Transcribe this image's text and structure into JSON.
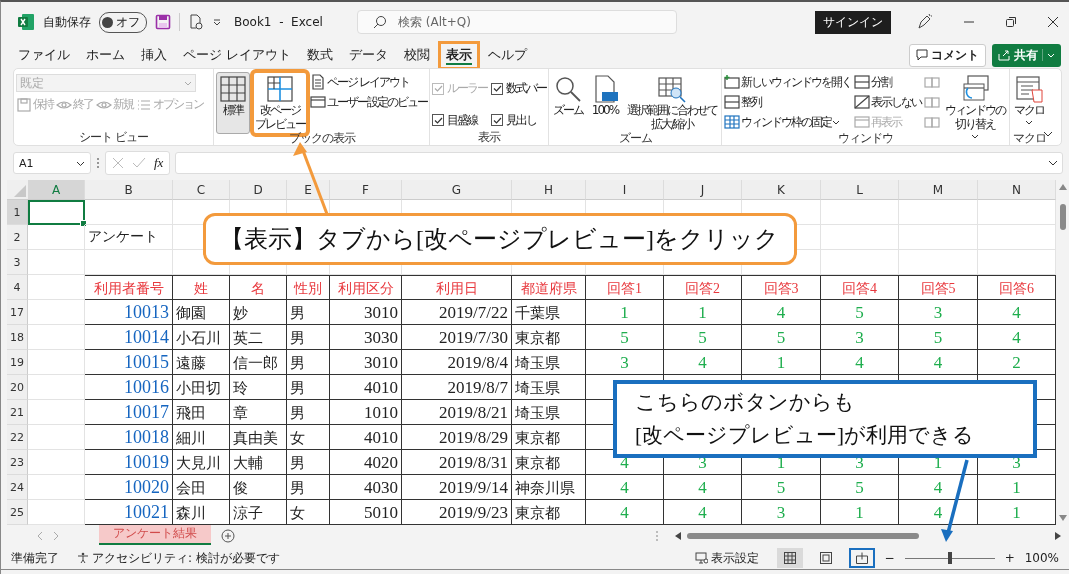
{
  "title_bar": {
    "autosave_label": "自動保存",
    "autosave_state": "オフ",
    "autosave_on": false,
    "document_title": "Book1  -  Excel",
    "search_placeholder": "検索 (Alt+Q)",
    "sign_in": "サインイン"
  },
  "menu_tabs": [
    {
      "label": "ファイル",
      "selected": false,
      "highlighted": false
    },
    {
      "label": "ホーム",
      "selected": false,
      "highlighted": false
    },
    {
      "label": "挿入",
      "selected": false,
      "highlighted": false
    },
    {
      "label": "ページ レイアウト",
      "selected": false,
      "highlighted": false
    },
    {
      "label": "数式",
      "selected": false,
      "highlighted": false
    },
    {
      "label": "データ",
      "selected": false,
      "highlighted": false
    },
    {
      "label": "校閲",
      "selected": false,
      "highlighted": false
    },
    {
      "label": "表示",
      "selected": true,
      "highlighted": true
    },
    {
      "label": "ヘルプ",
      "selected": false,
      "highlighted": false
    }
  ],
  "comment_button": "コメント",
  "share_button": "共有",
  "ribbon_groups": [
    {
      "label": "シート ビュー",
      "items": [
        {
          "kind": "dropdown",
          "label": "既定",
          "disabled": true
        },
        {
          "kind": "small",
          "label": "保持",
          "disabled": true
        },
        {
          "kind": "small",
          "label": "終了",
          "disabled": true
        },
        {
          "kind": "small",
          "label": "新規",
          "disabled": true
        },
        {
          "kind": "small",
          "label": "オプション",
          "disabled": true
        }
      ]
    },
    {
      "label": "ブックの表示",
      "items": [
        {
          "kind": "large",
          "lines": [
            "標準"
          ],
          "selected": true,
          "highlighted": false
        },
        {
          "kind": "large",
          "lines": [
            "改ページ",
            "プレビュー"
          ],
          "selected": false,
          "highlighted": true
        },
        {
          "kind": "small",
          "label": "ページ レイアウト",
          "disabled": false
        },
        {
          "kind": "small",
          "label": "ユーザー設定のビュー",
          "disabled": false
        }
      ]
    },
    {
      "label": "表示",
      "items": [
        {
          "kind": "check",
          "label": "ルーラー",
          "checked": true,
          "disabled": true
        },
        {
          "kind": "check",
          "label": "数式バー",
          "checked": true,
          "disabled": false
        },
        {
          "kind": "check",
          "label": "目盛線",
          "checked": true,
          "disabled": false
        },
        {
          "kind": "check",
          "label": "見出し",
          "checked": true,
          "disabled": false
        }
      ]
    },
    {
      "label": "ズーム",
      "items": [
        {
          "kind": "large",
          "lines": [
            "ズーム"
          ],
          "selected": false,
          "highlighted": false
        },
        {
          "kind": "large",
          "lines": [
            "100%"
          ],
          "selected": false,
          "highlighted": false
        },
        {
          "kind": "large",
          "lines": [
            "選択範囲に合わせて",
            "拡大/縮小"
          ],
          "selected": false,
          "highlighted": false
        }
      ]
    },
    {
      "label": "ウィンドウ",
      "items": [
        {
          "kind": "small",
          "label": "新しいウィンドウを開く",
          "disabled": false
        },
        {
          "kind": "small",
          "label": "整列",
          "disabled": false
        },
        {
          "kind": "small",
          "label": "ウィンドウ枠の固定",
          "disabled": false,
          "menu": true
        },
        {
          "kind": "small",
          "label": "分割",
          "disabled": false
        },
        {
          "kind": "small",
          "label": "表示しない",
          "disabled": false
        },
        {
          "kind": "small",
          "label": "再表示",
          "disabled": true
        },
        {
          "kind": "icon",
          "disabled": true
        },
        {
          "kind": "icon",
          "disabled": true
        },
        {
          "kind": "icon",
          "disabled": true
        },
        {
          "kind": "large",
          "lines": [
            "ウィンドウの",
            "切り替え"
          ],
          "selected": false,
          "highlighted": false,
          "menu": true
        }
      ]
    },
    {
      "label": "マクロ",
      "items": [
        {
          "kind": "large",
          "lines": [
            "マクロ"
          ],
          "selected": false,
          "highlighted": false,
          "menu": true
        }
      ]
    }
  ],
  "formula_bar": {
    "name_box": "A1",
    "function_label": "fx"
  },
  "sheet": {
    "columns": [
      "A",
      "B",
      "C",
      "D",
      "E",
      "F",
      "G",
      "H",
      "I",
      "J",
      "K",
      "L",
      "M",
      "N"
    ],
    "rows": [
      {
        "kind": "blank",
        "number": "1",
        "active_cell": true
      },
      {
        "kind": "title",
        "number": "2",
        "text": "アンケート"
      },
      {
        "kind": "blank",
        "number": "3",
        "active_cell": false
      },
      {
        "kind": "header",
        "number": "4",
        "labels": [
          "利用者番号",
          "姓",
          "名",
          "性別",
          "利用区分",
          "利用日",
          "都道府県",
          "回答1",
          "回答2",
          "回答3",
          "回答4",
          "回答5",
          "回答6"
        ]
      },
      {
        "kind": "record",
        "number": "17",
        "values": [
          "10013",
          "御園",
          "妙",
          "男",
          "3010",
          "2019/7/22",
          "千葉県"
        ],
        "answers": [
          "1",
          "1",
          "4",
          "5",
          "3",
          "4"
        ]
      },
      {
        "kind": "record",
        "number": "18",
        "values": [
          "10014",
          "小石川",
          "英二",
          "男",
          "3030",
          "2019/7/30",
          "東京都"
        ],
        "answers": [
          "5",
          "5",
          "5",
          "3",
          "5",
          "4"
        ]
      },
      {
        "kind": "record",
        "number": "19",
        "values": [
          "10015",
          "遠藤",
          "信一郎",
          "男",
          "3010",
          "2019/8/4",
          "埼玉県"
        ],
        "answers": [
          "3",
          "4",
          "1",
          "4",
          "4",
          "2"
        ]
      },
      {
        "kind": "record",
        "number": "20",
        "values": [
          "10016",
          "小田切",
          "玲",
          "男",
          "4010",
          "2019/8/7",
          "埼玉県"
        ]
      },
      {
        "kind": "record",
        "number": "21",
        "values": [
          "10017",
          "飛田",
          "章",
          "男",
          "1010",
          "2019/8/21",
          "埼玉県"
        ]
      },
      {
        "kind": "record",
        "number": "22",
        "values": [
          "10018",
          "細川",
          "真由美",
          "女",
          "4010",
          "2019/8/29",
          "東京都"
        ]
      },
      {
        "kind": "record",
        "number": "23",
        "values": [
          "10019",
          "大見川",
          "大輔",
          "男",
          "4020",
          "2019/8/31",
          "東京都"
        ],
        "answers": [
          "4",
          "3",
          "1",
          "3",
          "1",
          "3"
        ]
      },
      {
        "kind": "record",
        "number": "24",
        "values": [
          "10020",
          "会田",
          "俊",
          "男",
          "4030",
          "2019/9/14",
          "神奈川県"
        ],
        "answers": [
          "4",
          "4",
          "5",
          "5",
          "4",
          "1"
        ]
      },
      {
        "kind": "record",
        "number": "25",
        "values": [
          "10021",
          "森川",
          "涼子",
          "女",
          "5010",
          "2019/9/23",
          "東京都"
        ],
        "answers": [
          "4",
          "4",
          "3",
          "1",
          "4",
          "1"
        ]
      }
    ]
  },
  "sheet_tabs": [
    {
      "label": "アンケート結果",
      "selected": true
    }
  ],
  "status_bar": {
    "ready": "準備完了",
    "accessibility": "アクセシビリティ: 検討が必要です",
    "display_settings": "表示設定",
    "view_buttons": [
      {
        "selected": true,
        "highlighted": false
      },
      {
        "selected": false,
        "highlighted": false
      },
      {
        "selected": false,
        "highlighted": true
      }
    ],
    "zoom_out": "−",
    "zoom_in": "+",
    "zoom": {
      "level": 0.5,
      "reading": "100%"
    }
  },
  "callouts": [
    {
      "kind": "rounded",
      "lines": [
        "【表示】タブから[改ページプレビュー]をクリック"
      ]
    },
    {
      "kind": "square",
      "lines": [
        "こちらのボタンからも",
        "[改ページプレビュー]が利用できる"
      ]
    }
  ]
}
